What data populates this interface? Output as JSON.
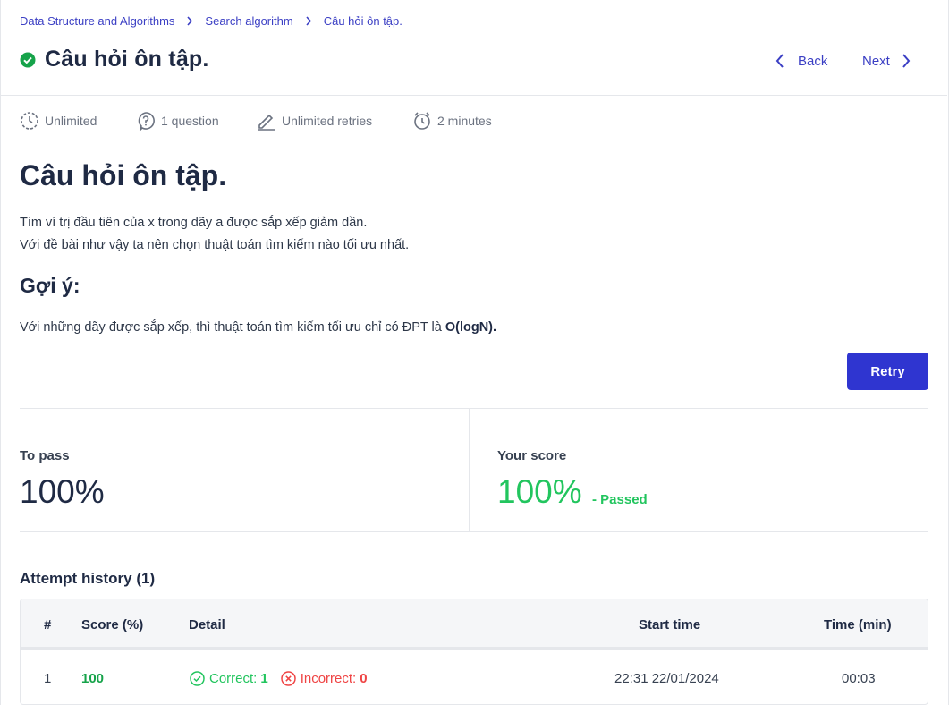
{
  "breadcrumb": [
    "Data Structure and Algorithms",
    "Search algorithm",
    "Câu hỏi ôn tập."
  ],
  "header": {
    "title": "Câu hỏi ôn tập.",
    "back_label": "Back",
    "next_label": "Next"
  },
  "meta": {
    "time_limit": "Unlimited",
    "questions": "1 question",
    "retries": "Unlimited retries",
    "duration": "2 minutes"
  },
  "content": {
    "title": "Câu hỏi ôn tập.",
    "line1": "Tìm ví trị đầu tiên của x trong dãy a được sắp xếp giảm dần.",
    "line2": "Với đề bài như vậy ta nên chọn thuật toán tìm kiếm nào tối ưu nhất.",
    "hint_title": "Gợi ý:",
    "hint_text": "Với những dãy được sắp xếp, thì thuật toán tìm kiếm tối ưu chỉ có ĐPT là ",
    "hint_bold": "O(logN)."
  },
  "retry_label": "Retry",
  "score": {
    "to_pass_label": "To pass",
    "to_pass_value": "100%",
    "your_score_label": "Your score",
    "your_score_value": "100%",
    "status": "- Passed"
  },
  "attempts": {
    "title": "Attempt history (1)",
    "columns": [
      "#",
      "Score (%)",
      "Detail",
      "Start time",
      "Time (min)"
    ],
    "rows": [
      {
        "index": "1",
        "score": "100",
        "correct_label": "Correct:",
        "correct": "1",
        "incorrect_label": "Incorrect:",
        "incorrect": "0",
        "start_time": "22:31 22/01/2024",
        "time": "00:03"
      }
    ]
  },
  "colors": {
    "accent": "#2f35d0",
    "link": "#3b3fc4",
    "success": "#22c55e",
    "danger": "#ef4444"
  }
}
